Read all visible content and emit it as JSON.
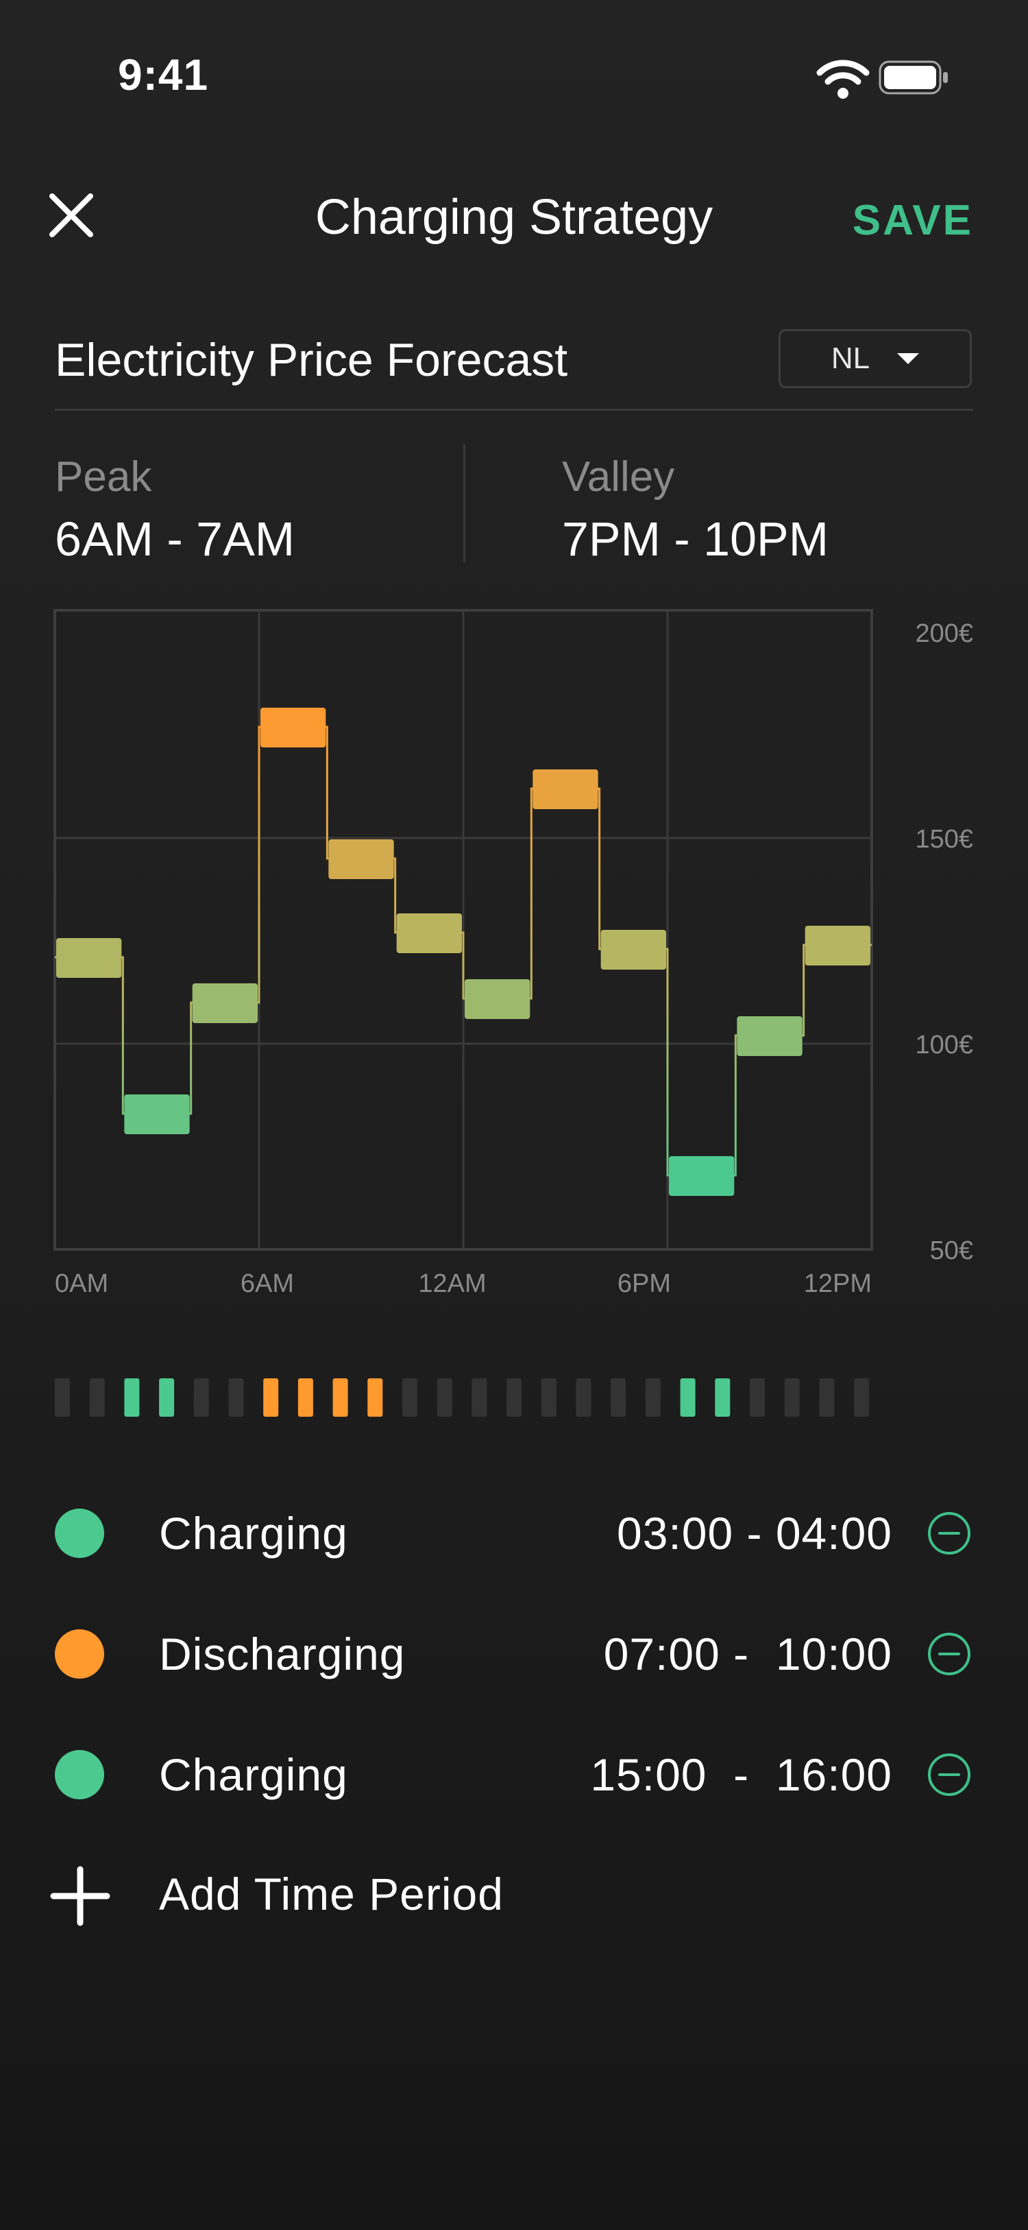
{
  "status_bar": {
    "time": "9:41"
  },
  "header": {
    "title": "Charging Strategy",
    "save_label": "SAVE",
    "close_icon": "close-icon"
  },
  "forecast": {
    "title": "Electricity Price Forecast",
    "region": "NL",
    "peak": {
      "label": "Peak",
      "value": "6AM - 7AM"
    },
    "valley": {
      "label": "Valley",
      "value": "7PM - 10PM"
    }
  },
  "colors": {
    "accent": "#3fbf8a",
    "charge": "#4cc98f",
    "discharge": "#ff9a2e",
    "mid": "#b8b560"
  },
  "chart_data": {
    "type": "bar",
    "x_tick_labels": [
      "0AM",
      "6AM",
      "12AM",
      "6PM",
      "12PM"
    ],
    "y_tick_labels": [
      "200€",
      "150€",
      "100€",
      "50€"
    ],
    "ylim": [
      50,
      200
    ],
    "categories": [
      "0-2h",
      "2-4h",
      "4-6h",
      "6-8h",
      "8-10h",
      "10-12h",
      "12-14h",
      "14-16h",
      "16-18h",
      "18-20h",
      "20-22h",
      "22-24h"
    ],
    "values": [
      121,
      83,
      110,
      177,
      145,
      127,
      111,
      162,
      123,
      68,
      102,
      124
    ],
    "grid": true
  },
  "schedule_strip": {
    "slots": [
      "off",
      "off",
      "charge",
      "charge",
      "off",
      "off",
      "discharge",
      "discharge",
      "discharge",
      "discharge",
      "off",
      "off",
      "off",
      "off",
      "off",
      "off",
      "off",
      "off",
      "charge",
      "charge",
      "off",
      "off",
      "off",
      "off"
    ]
  },
  "periods": [
    {
      "type": "charge",
      "label": "Charging",
      "start": "03:00",
      "end": "04:00",
      "sep": " - "
    },
    {
      "type": "discharge",
      "label": "Discharging",
      "start": "07:00",
      "end": "10:00",
      "sep": " -  "
    },
    {
      "type": "charge",
      "label": "Charging",
      "start": "15:00",
      "end": "16:00",
      "sep": "  -  "
    }
  ],
  "add_period_label": "Add Time Period"
}
